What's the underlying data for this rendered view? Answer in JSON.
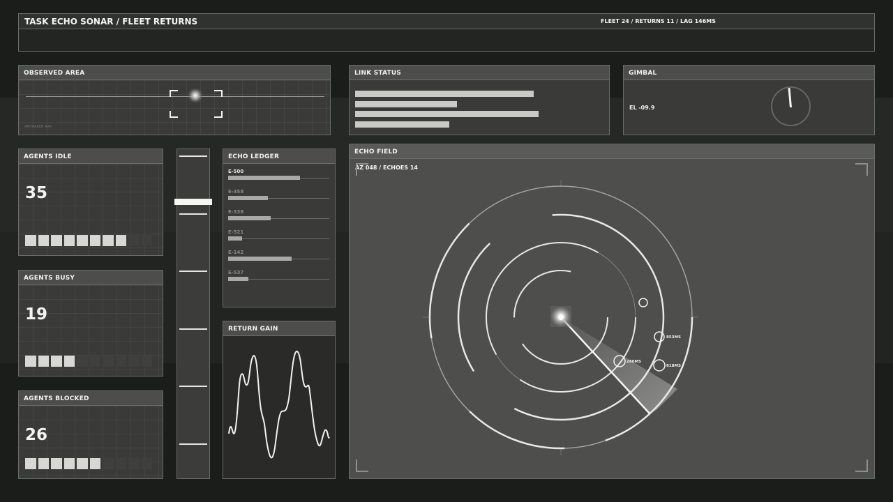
{
  "header": {
    "title": "TASK ECHO SONAR / FLEET RETURNS",
    "status": "FLEET 24 / RETURNS 11 / LAG 146MS"
  },
  "observed_area": {
    "title": "OBSERVED AREA",
    "caption": "AMTRAKER AAR"
  },
  "link_status": {
    "title": "LINK STATUS",
    "bars": [
      0.72,
      0.41,
      0.74,
      0.38
    ]
  },
  "gimbal": {
    "title": "GIMBAL",
    "elevation": "EL -09.9"
  },
  "agents": [
    {
      "title": "AGENTS IDLE",
      "count": "35",
      "lit_blocks": 8,
      "total_blocks": 10
    },
    {
      "title": "AGENTS BUSY",
      "count": "19",
      "lit_blocks": 4,
      "total_blocks": 10
    },
    {
      "title": "AGENTS BLOCKED",
      "count": "26",
      "lit_blocks": 6,
      "total_blocks": 10
    }
  ],
  "slider": {
    "level": 0.77
  },
  "echo_ledger": {
    "title": "ECHO LEDGER",
    "rows": [
      {
        "id": "E-500",
        "value": 0.71
      },
      {
        "id": "E-458",
        "value": 0.39
      },
      {
        "id": "E-338",
        "value": 0.42
      },
      {
        "id": "E-521",
        "value": 0.14
      },
      {
        "id": "E-142",
        "value": 0.63
      },
      {
        "id": "E-537",
        "value": 0.2
      }
    ]
  },
  "return_gain": {
    "title": "RETURN GAIN"
  },
  "echo_field": {
    "title": "ECHO FIELD",
    "readout": "AZ 048 / ECHOES 14",
    "contacts": [
      {
        "label": ""
      },
      {
        "label": "853MS"
      },
      {
        "label": "260MS"
      },
      {
        "label": "818MS"
      }
    ]
  },
  "colors": {
    "background": "#1b1d1b",
    "panel": "#3a3b39",
    "panel_header": "#4d4e4c",
    "line": "#e8e8e4"
  }
}
